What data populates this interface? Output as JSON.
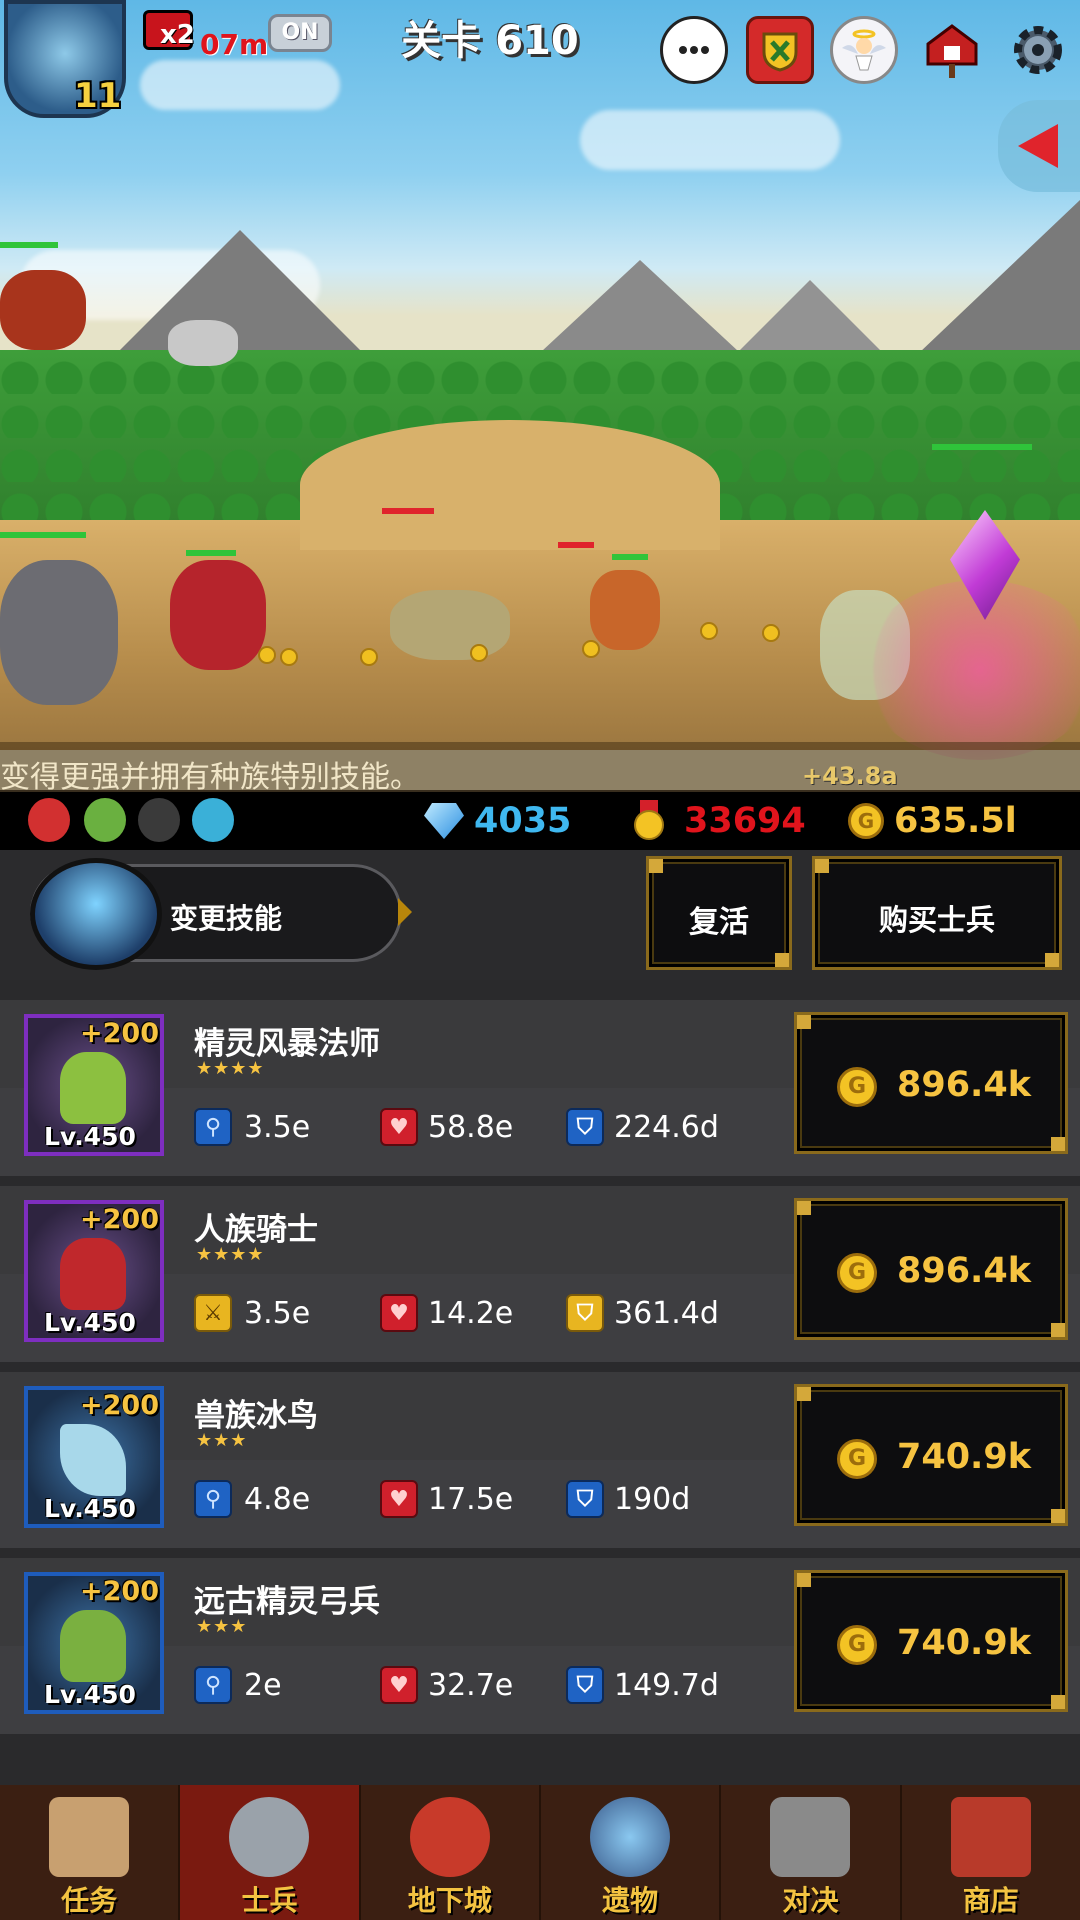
{
  "hud": {
    "player_level": "11",
    "speed_multiplier": "x2",
    "speed_time_left": "07m",
    "auto_toggle": "ON",
    "stage_title": "关卡 610",
    "buttons": [
      "chat-icon",
      "guild-shield-icon",
      "angel-icon",
      "mailbox-icon",
      "gear-icon"
    ],
    "side_panel_toggle": "collapse-arrow-icon"
  },
  "battle": {
    "tip_text": "变得更强并拥有种族特别技能。",
    "floating_gain": "+43.8a"
  },
  "resources": {
    "races": [
      "human-race-icon",
      "elf-race-icon",
      "undead-race-icon",
      "orc-race-icon"
    ],
    "gems": "4035",
    "medals": "33694",
    "gold": "635.5l",
    "colors": {
      "gems": "#3fb8f0",
      "medals": "#e0141c",
      "gold": "#f6c341"
    }
  },
  "actions": {
    "change_skill": "变更技能",
    "revive": "复活",
    "buy_soldier": "购买士兵"
  },
  "soldiers": [
    {
      "name": "精灵风暴法师",
      "stars": "★★★★",
      "bonus": "+200",
      "level": "Lv.450",
      "frame": "purple",
      "attack": "3.5e",
      "hp": "58.8e",
      "defense": "224.6d",
      "price": "896.4k"
    },
    {
      "name": "人族骑士",
      "stars": "★★★★",
      "bonus": "+200",
      "level": "Lv.450",
      "frame": "purple",
      "attack": "3.5e",
      "hp": "14.2e",
      "defense": "361.4d",
      "price": "896.4k"
    },
    {
      "name": "兽族冰鸟",
      "stars": "★★★",
      "bonus": "+200",
      "level": "Lv.450",
      "frame": "blue",
      "attack": "4.8e",
      "hp": "17.5e",
      "defense": "190d",
      "price": "740.9k"
    },
    {
      "name": "远古精灵弓兵",
      "stars": "★★★",
      "bonus": "+200",
      "level": "Lv.450",
      "frame": "blue",
      "attack": "2e",
      "hp": "32.7e",
      "defense": "149.7d",
      "price": "740.9k"
    }
  ],
  "nav": {
    "active": "士兵",
    "items": [
      "任务",
      "士兵",
      "地下城",
      "遗物",
      "对决",
      "商店"
    ],
    "icons": [
      "scroll-icon",
      "knight-helmet-icon",
      "monster-plant-icon",
      "relic-orb-icon",
      "crossed-swords-icon",
      "shop-icon"
    ]
  }
}
